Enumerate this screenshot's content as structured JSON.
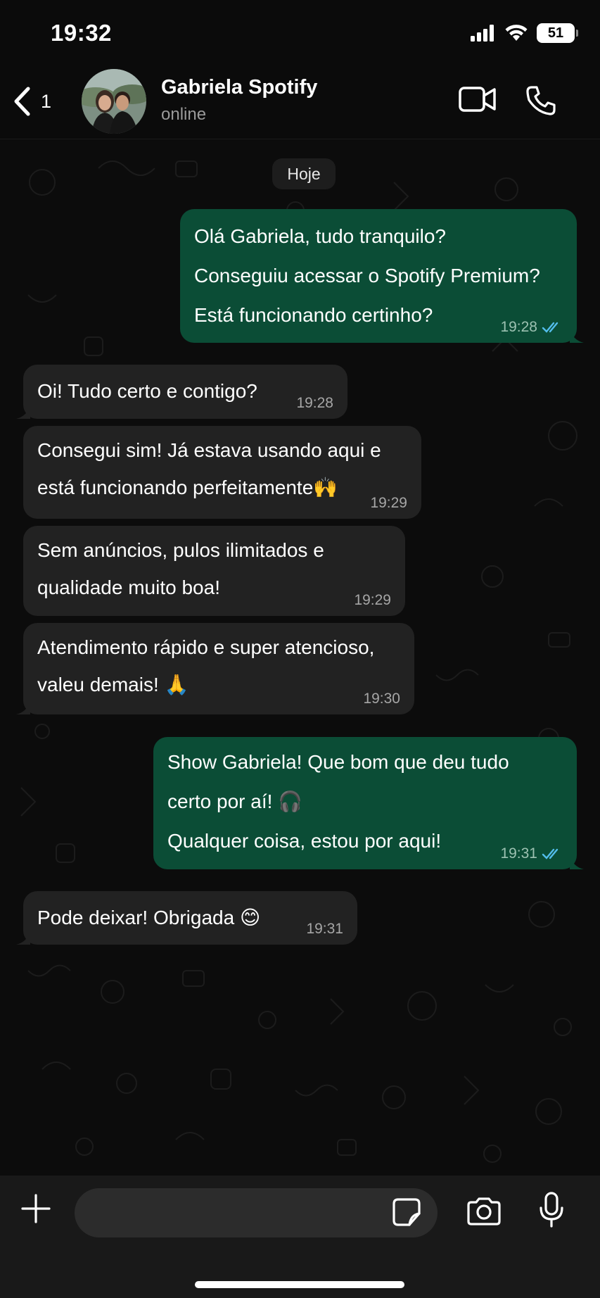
{
  "status_bar": {
    "time": "19:32",
    "battery": "51"
  },
  "header": {
    "back_count": "1",
    "contact_name": "Gabriela Spotify",
    "contact_status": "online"
  },
  "chat": {
    "date": "Hoje",
    "messages": [
      {
        "direction": "out",
        "lines": [
          "Olá Gabriela, tudo tranquilo?",
          "Conseguiu acessar o Spotify Premium?",
          "Está funcionando certinho?"
        ],
        "time": "19:28",
        "read": true
      },
      {
        "direction": "in",
        "lines": [
          "Oi! Tudo certo e contigo?"
        ],
        "time": "19:28"
      },
      {
        "direction": "in",
        "lines": [
          "Consegui sim! Já estava usando aqui e",
          "está funcionando perfeitamente🙌"
        ],
        "time": "19:29"
      },
      {
        "direction": "in",
        "lines": [
          "Sem anúncios, pulos ilimitados e",
          "qualidade muito boa!"
        ],
        "time": "19:29"
      },
      {
        "direction": "in",
        "lines": [
          "Atendimento rápido e super atencioso,",
          "valeu demais! 🙏"
        ],
        "time": "19:30"
      },
      {
        "direction": "out",
        "lines": [
          "Show Gabriela! Que bom que deu tudo",
          "certo por aí! 🎧",
          "Qualquer coisa, estou por aqui!"
        ],
        "time": "19:31",
        "read": true
      },
      {
        "direction": "in",
        "lines": [
          "Pode deixar! Obrigada 😊"
        ],
        "time": "19:31"
      }
    ]
  },
  "composer": {
    "input_value": ""
  },
  "colors": {
    "outgoing_bubble": "#0b4d36",
    "incoming_bubble": "#222222",
    "read_ticks": "#53bdeb",
    "background": "#0b0b0b"
  },
  "icons": [
    "back-chevron-icon",
    "video-camera-icon",
    "phone-icon",
    "plus-icon",
    "sticker-icon",
    "camera-icon",
    "microphone-icon",
    "signal-icon",
    "wifi-icon",
    "battery-icon"
  ]
}
